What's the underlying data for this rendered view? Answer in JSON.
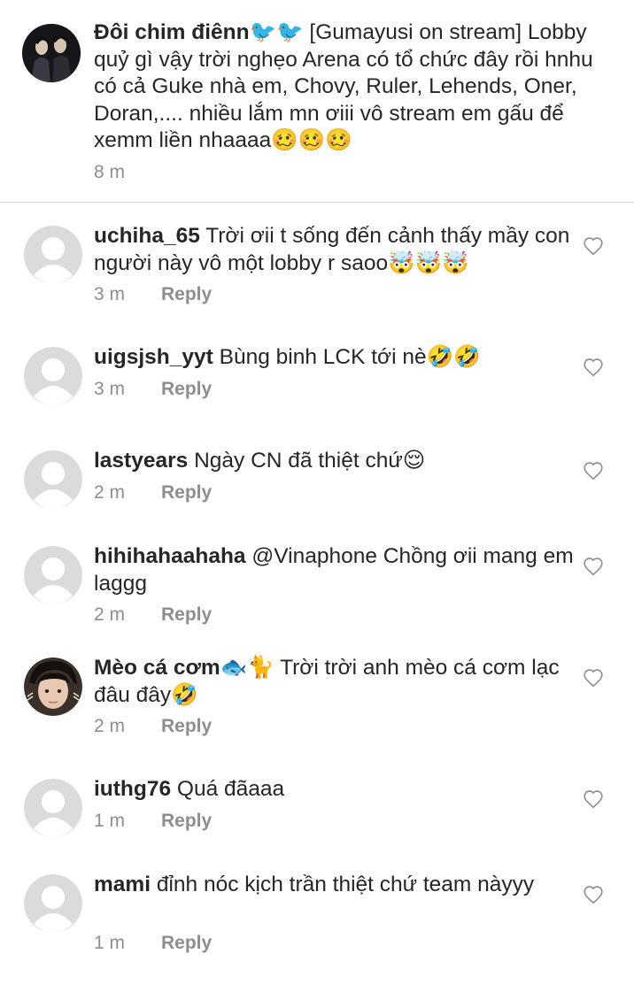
{
  "caption": {
    "username": "Đôi chim điênn🐦🐦",
    "text": " [Gumayusi on stream] Lobby quỷ gì vậy trời nghẹo Arena có tổ chức đây rồi hnhu có cả Guke nhà em, Chovy, Ruler, Lehends, Oner, Doran,.... nhiều lắm mn ơiii vô stream em gấu để xemm liền nhaaaa🥴🥴🥴",
    "time": "8 m"
  },
  "reply_label": "Reply",
  "comments": [
    {
      "username": "uchiha_65",
      "text": " Trời ơii t sống đến cảnh thấy mầy con người này vô một lobby r saoo🤯🤯🤯",
      "time": "3 m",
      "avatar": "default-avatar"
    },
    {
      "username": "uigsjsh_yyt",
      "text": " Bùng binh LCK tới nè🤣🤣",
      "time": "3 m",
      "avatar": "default-avatar"
    },
    {
      "username": "lastyears",
      "text": " Ngày CN đã thiệt chứ😌",
      "time": "2 m",
      "avatar": "default-avatar"
    },
    {
      "username": "hihihahaahaha",
      "text": " @Vinaphone Chồng ơii mang em laggg",
      "time": "2 m",
      "avatar": "default-avatar"
    },
    {
      "username": "Mèo cá cơm🐟🐈",
      "text": " Trời trời anh mèo cá cơm lạc đâu đây🤣",
      "time": "2 m",
      "avatar": "photo-avatar"
    },
    {
      "username": "iuthg76",
      "text": " Quá đãaaa",
      "time": "1 m",
      "avatar": "default-avatar"
    },
    {
      "username": "mami",
      "text": " đỉnh nóc kịch trần thiệt chứ team nàyyy",
      "time": "1 m",
      "avatar": "default-avatar"
    }
  ],
  "icons": {
    "like": "heart-outline-icon",
    "default_avatar": "person-silhouette-icon"
  },
  "colors": {
    "text": "#262626",
    "secondary": "#8e8e8e",
    "divider": "#dbdbdb",
    "avatar_bg": "#dbdbdb"
  }
}
